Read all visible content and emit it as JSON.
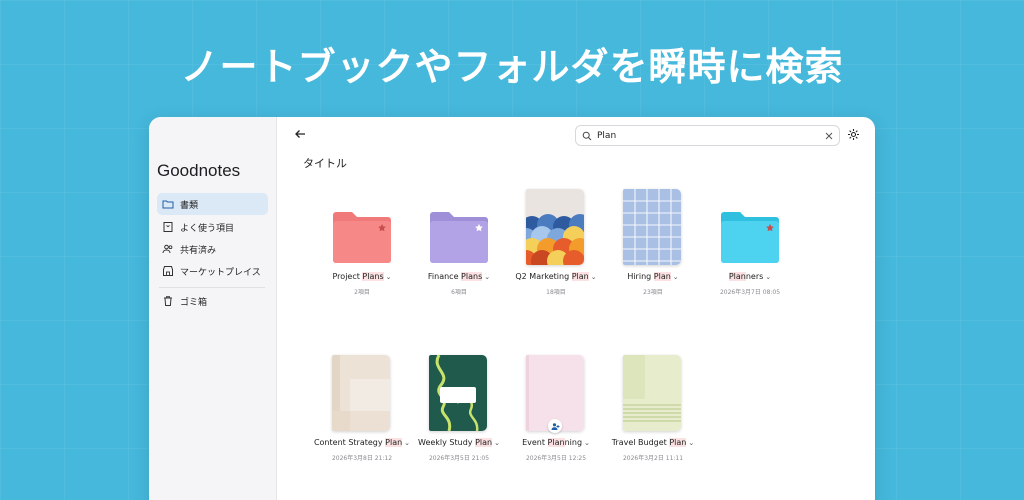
{
  "headline": "ノートブックやフォルダを瞬時に検索",
  "sidebar": {
    "brand": "Goodnotes",
    "items": [
      {
        "label": "書類",
        "icon": "folder-icon"
      },
      {
        "label": "よく使う項目",
        "icon": "bookmark-icon"
      },
      {
        "label": "共有済み",
        "icon": "people-icon"
      },
      {
        "label": "マーケットプレイス",
        "icon": "store-icon"
      },
      {
        "label": "ゴミ箱",
        "icon": "trash-icon"
      }
    ]
  },
  "search": {
    "value": "Plan"
  },
  "section_title": "タイトル",
  "items": [
    {
      "prefix": "Project ",
      "match": "Plans",
      "suffix": "",
      "meta": "2項目",
      "kind": "folder",
      "color": "#f07a7a"
    },
    {
      "prefix": "Finance ",
      "match": "Plans",
      "suffix": "",
      "meta": "6項目",
      "kind": "folder",
      "color": "#ab9be0"
    },
    {
      "prefix": "Q2 Marketing ",
      "match": "Plan",
      "suffix": "",
      "meta": "18項目",
      "kind": "notebook-waves"
    },
    {
      "prefix": "Hiring ",
      "match": "Plan",
      "suffix": "",
      "meta": "23項目",
      "kind": "notebook-grid"
    },
    {
      "prefix": "",
      "match": "Plan",
      "suffix": "ners",
      "meta": "2026年3月7日 08:05",
      "kind": "folder",
      "color": "#48d2ee"
    },
    {
      "prefix": "Content Strategy ",
      "match": "Plan",
      "suffix": "",
      "meta": "2026年3月8日 21:12",
      "kind": "notebook-beige"
    },
    {
      "prefix": "Weekly Study ",
      "match": "Plan",
      "suffix": "",
      "meta": "2026年3月5日 21:05",
      "kind": "notebook-green"
    },
    {
      "prefix": "Event ",
      "match": "Plan",
      "suffix": "ning",
      "meta": "2026年3月5日 12:25",
      "kind": "notebook-pink"
    },
    {
      "prefix": "Travel Budget ",
      "match": "Plan",
      "suffix": "",
      "meta": "2026年3月2日 11:11",
      "kind": "notebook-lime"
    }
  ]
}
